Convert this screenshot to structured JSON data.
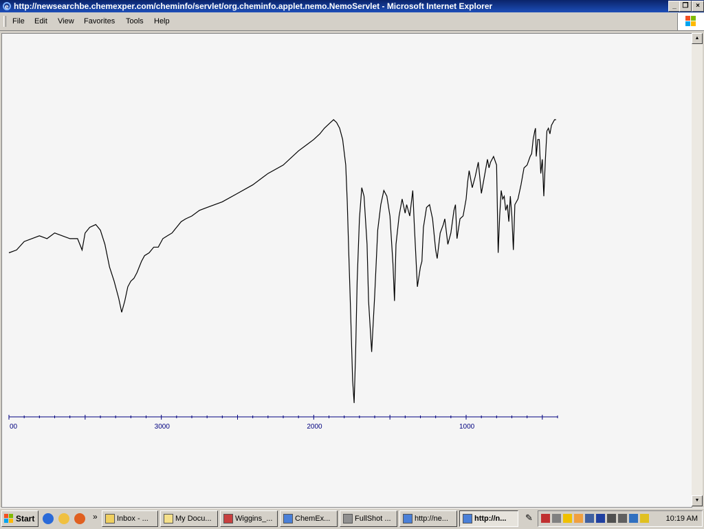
{
  "window": {
    "title": "http://newsearchbe.chemexper.com/cheminfo/servlet/org.cheminfo.applet.nemo.NemoServlet - Microsoft Internet Explorer",
    "controls": {
      "minimize": "_",
      "maximize": "❐",
      "close": "×"
    }
  },
  "menu": {
    "items": [
      "File",
      "Edit",
      "View",
      "Favorites",
      "Tools",
      "Help"
    ]
  },
  "chart_data": {
    "type": "line",
    "x_axis_labels": [
      "00",
      "3000",
      "2000",
      "1000"
    ],
    "xlim": [
      4000,
      400
    ],
    "x_reversed": true,
    "line_color": "#000000",
    "axis_color": "#00007f",
    "series": [
      {
        "x": [
          4000,
          3950,
          3900,
          3850,
          3800,
          3750,
          3700,
          3650,
          3600,
          3550,
          3520,
          3500,
          3470,
          3430,
          3400,
          3370,
          3340,
          3310,
          3280,
          3260,
          3240,
          3220,
          3200,
          3180,
          3160,
          3130,
          3110,
          3080,
          3050,
          3020,
          2990,
          2960,
          2930,
          2900,
          2870,
          2840,
          2800,
          2750,
          2700,
          2600,
          2500,
          2400,
          2300,
          2200,
          2100,
          2050,
          2000,
          1960,
          1930,
          1910,
          1890,
          1870,
          1850,
          1830,
          1810,
          1790,
          1780,
          1770,
          1760,
          1745,
          1735,
          1725,
          1715,
          1700,
          1685,
          1670,
          1650,
          1640,
          1620,
          1600,
          1580,
          1560,
          1540,
          1520,
          1500,
          1480,
          1470,
          1460,
          1440,
          1420,
          1400,
          1390,
          1370,
          1350,
          1340,
          1320,
          1300,
          1290,
          1280,
          1260,
          1240,
          1220,
          1200,
          1190,
          1170,
          1150,
          1140,
          1120,
          1100,
          1080,
          1070,
          1060,
          1040,
          1020,
          1000,
          990,
          980,
          960,
          940,
          920,
          900,
          880,
          860,
          850,
          840,
          820,
          800,
          790,
          780,
          770,
          760,
          750,
          740,
          730,
          720,
          710,
          700,
          690,
          680,
          660,
          640,
          620,
          600,
          580,
          570,
          560,
          550,
          545,
          540,
          530,
          520,
          510,
          500,
          490,
          480,
          470,
          460,
          450,
          440,
          420,
          410
        ],
        "y": [
          55,
          56,
          59,
          60,
          61,
          60,
          62,
          61,
          60,
          60,
          56,
          62,
          64,
          65,
          63,
          58,
          50,
          45,
          39,
          34,
          38,
          43,
          45,
          46,
          48,
          52,
          54,
          55,
          57,
          57,
          60,
          61,
          62,
          64,
          66,
          67,
          68,
          70,
          71,
          73,
          76,
          79,
          83,
          86,
          91,
          93,
          95,
          97,
          99,
          100,
          101,
          102,
          101,
          99,
          95,
          86,
          73,
          55,
          38,
          10,
          2,
          20,
          45,
          67,
          78,
          75,
          58,
          38,
          20,
          40,
          63,
          72,
          77,
          75,
          68,
          51,
          38,
          58,
          68,
          74,
          69,
          72,
          68,
          77,
          65,
          43,
          50,
          52,
          64,
          71,
          72,
          67,
          56,
          53,
          62,
          65,
          67,
          58,
          62,
          70,
          72,
          60,
          67,
          68,
          74,
          80,
          84,
          78,
          82,
          87,
          76,
          82,
          88,
          85,
          87,
          89,
          86,
          55,
          68,
          77,
          74,
          75,
          70,
          72,
          66,
          75,
          68,
          56,
          72,
          74,
          79,
          85,
          86,
          89,
          90,
          95,
          98,
          99,
          89,
          95,
          95,
          83,
          88,
          75,
          88,
          98,
          99,
          97,
          100,
          102,
          102
        ]
      }
    ]
  },
  "taskbar": {
    "start_label": "Start",
    "buttons": [
      "Inbox - ...",
      "My Docu...",
      "Wiggins_...",
      "ChemEx...",
      "FullShot ...",
      "http://ne...",
      "http://n..."
    ],
    "active_index": 6,
    "clock": "10:19 AM"
  }
}
